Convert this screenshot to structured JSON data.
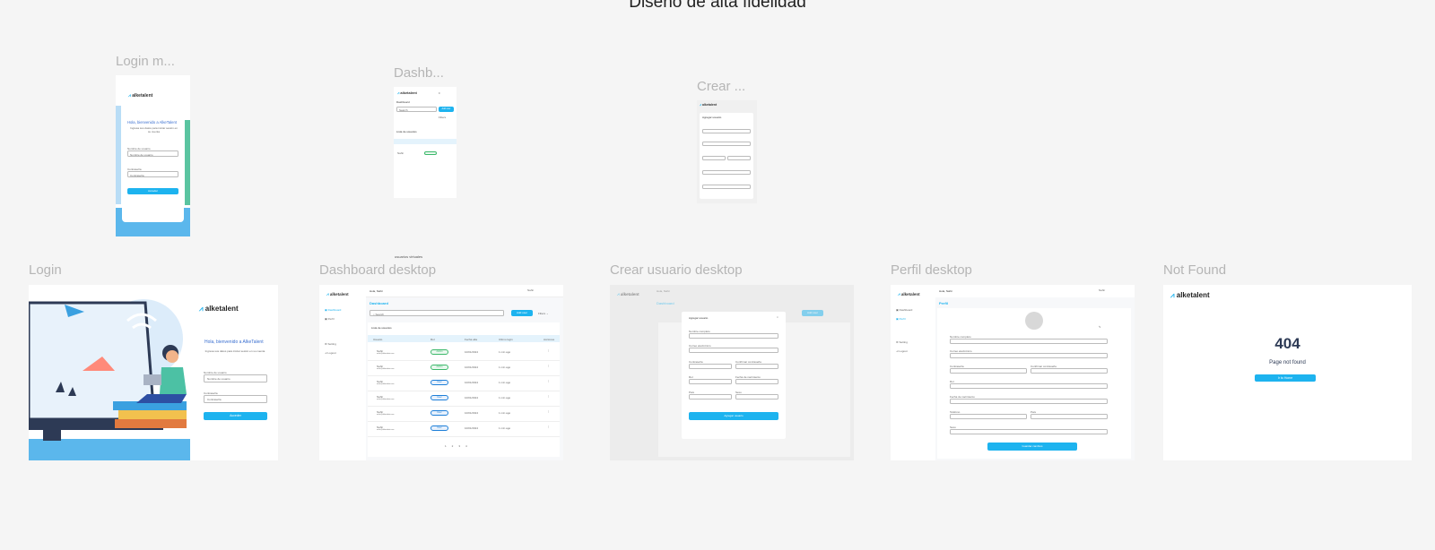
{
  "page": {
    "title": "Diseño de alta fidelidad"
  },
  "frames": {
    "login_mobile": {
      "label": "Login m..."
    },
    "dashboard_mobile": {
      "label": "Dashb..."
    },
    "crear_mobile": {
      "label": "Crear ..."
    },
    "login_desktop": {
      "label": "Login"
    },
    "dashboard_desktop": {
      "label": "Dashboard desktop"
    },
    "crear_desktop": {
      "label": "Crear usuario desktop"
    },
    "perfil_desktop": {
      "label": "Perfil desktop"
    },
    "not_found": {
      "label": "Not Found"
    }
  },
  "tiny_caption": "usuarios virtuales",
  "brand": {
    "name": "alketalent",
    "accent": "#1db3ef"
  },
  "login": {
    "welcome": "Hola, bienvenido a AlkeTalent",
    "subtitle": "Ingresa sus datos para iniciar sesión en su cuenta",
    "user_label": "Nombre de usuario",
    "user_placeholder": "Nombre de usuario",
    "pass_label": "Contraseña",
    "pass_placeholder": "Contraseña",
    "submit": "Acceder"
  },
  "dashboard": {
    "greeting": "Hola, Nahir",
    "user_name": "Nahir",
    "user_role": "Admin",
    "title": "Dashboard",
    "nav_dashboard": "Dashboard",
    "nav_perfil": "Perfil",
    "nav_settings": "Setting",
    "nav_logout": "Logout",
    "search_placeholder": "Search",
    "add_button": "Add user",
    "filters": "Filters",
    "list_title": "Lista de usuarios",
    "columns": [
      "Usuario",
      "Rol",
      "Fecha alta",
      "Ultimo login",
      "Acciones"
    ],
    "rows": [
      {
        "name": "Nahir",
        "email": "nahir@alketalent.com",
        "role": "Admin",
        "alta": "10/01/2024",
        "login": "1 min ago"
      },
      {
        "name": "Nahir",
        "email": "nahir@alketalent.com",
        "role": "Admin",
        "alta": "10/01/2024",
        "login": "1 min ago"
      },
      {
        "name": "Nahir",
        "email": "nahir@alketalent.com",
        "role": "User",
        "alta": "10/01/2024",
        "login": "1 min ago"
      },
      {
        "name": "Nahir",
        "email": "nahir@alketalent.com",
        "role": "User",
        "alta": "10/01/2024",
        "login": "1 min ago"
      },
      {
        "name": "Nahir",
        "email": "nahir@alketalent.com",
        "role": "User",
        "alta": "10/01/2024",
        "login": "1 min ago"
      },
      {
        "name": "Nahir",
        "email": "nahir@alketalent.com",
        "role": "User",
        "alta": "10/01/2024",
        "login": "1 min ago"
      }
    ],
    "pages": [
      "1",
      "2",
      "3",
      "4"
    ]
  },
  "crear": {
    "modal_title": "Agregar usuario",
    "nombre": "Nombre completo",
    "correo": "Correo electrónico",
    "contrasena": "Contraseña",
    "confirmar": "Confirmar contraseña",
    "rol": "Rol",
    "fecha": "Fecha de nacimiento",
    "pais": "País",
    "sexo": "Sexo",
    "submit": "Agregar usuario"
  },
  "perfil": {
    "title": "Perfil",
    "fields": [
      "Nombre completo",
      "Correo electrónico",
      "Contraseña",
      "Confirmar contraseña",
      "Rol",
      "Fecha de nacimiento",
      "Teléfono",
      "País",
      "Sexo"
    ],
    "submit": "Guardar cambios"
  },
  "not_found": {
    "code": "404",
    "message": "Page not found",
    "button": "Ir to Home"
  }
}
